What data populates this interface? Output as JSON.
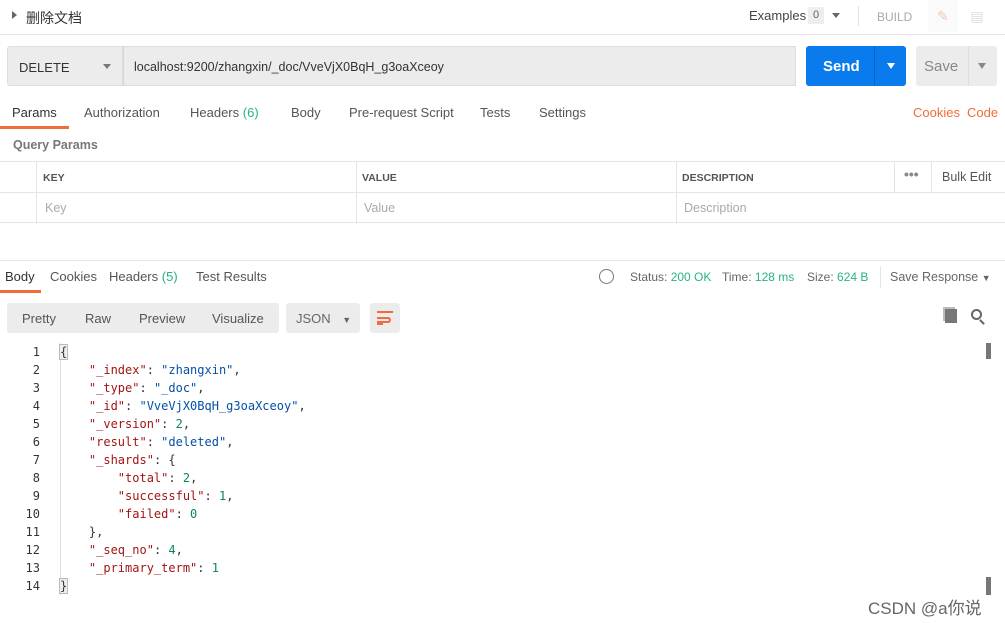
{
  "header": {
    "title": "删除文档",
    "examples_label": "Examples",
    "examples_count": "0",
    "build_label": "BUILD",
    "edit_icon": "pencil-icon",
    "comment_icon": "comment-icon"
  },
  "request": {
    "method": "DELETE",
    "url": "localhost:9200/zhangxin/_doc/VveVjX0BqH_g3oaXceoy",
    "send_label": "Send",
    "save_label": "Save"
  },
  "request_tabs": [
    {
      "label": "Params"
    },
    {
      "label": "Authorization"
    },
    {
      "label": "Headers",
      "count": "(6)"
    },
    {
      "label": "Body"
    },
    {
      "label": "Pre-request Script"
    },
    {
      "label": "Tests"
    },
    {
      "label": "Settings"
    }
  ],
  "links": {
    "cookies": "Cookies",
    "code": "Code"
  },
  "query_params": {
    "title": "Query Params",
    "columns": [
      "KEY",
      "VALUE",
      "DESCRIPTION"
    ],
    "bulk_edit": "Bulk Edit",
    "placeholders": {
      "key": "Key",
      "value": "Value",
      "description": "Description"
    }
  },
  "response_tabs": [
    {
      "label": "Body"
    },
    {
      "label": "Cookies"
    },
    {
      "label": "Headers",
      "count": "(5)"
    },
    {
      "label": "Test Results"
    }
  ],
  "status": {
    "status_label": "Status:",
    "status_value": "200 OK",
    "time_label": "Time:",
    "time_value": "128 ms",
    "size_label": "Size:",
    "size_value": "624 B",
    "save_response": "Save Response"
  },
  "view_modes": [
    "Pretty",
    "Raw",
    "Preview",
    "Visualize"
  ],
  "format": "JSON",
  "colors": {
    "accent": "#f26b3a",
    "send": "#097bed",
    "success": "#26b47f",
    "json_key": "#a31515",
    "json_string": "#0451a5",
    "json_number": "#098658"
  },
  "code_lines": [
    [
      [
        "p",
        "{"
      ]
    ],
    [
      [
        "p",
        "    "
      ],
      [
        "k",
        "\"_index\""
      ],
      [
        "p",
        ": "
      ],
      [
        "s",
        "\"zhangxin\""
      ],
      [
        "p",
        ","
      ]
    ],
    [
      [
        "p",
        "    "
      ],
      [
        "k",
        "\"_type\""
      ],
      [
        "p",
        ": "
      ],
      [
        "s",
        "\"_doc\""
      ],
      [
        "p",
        ","
      ]
    ],
    [
      [
        "p",
        "    "
      ],
      [
        "k",
        "\"_id\""
      ],
      [
        "p",
        ": "
      ],
      [
        "s",
        "\"VveVjX0BqH_g3oaXceoy\""
      ],
      [
        "p",
        ","
      ]
    ],
    [
      [
        "p",
        "    "
      ],
      [
        "k",
        "\"_version\""
      ],
      [
        "p",
        ": "
      ],
      [
        "n",
        "2"
      ],
      [
        "p",
        ","
      ]
    ],
    [
      [
        "p",
        "    "
      ],
      [
        "k",
        "\"result\""
      ],
      [
        "p",
        ": "
      ],
      [
        "s",
        "\"deleted\""
      ],
      [
        "p",
        ","
      ]
    ],
    [
      [
        "p",
        "    "
      ],
      [
        "k",
        "\"_shards\""
      ],
      [
        "p",
        ": {"
      ]
    ],
    [
      [
        "p",
        "        "
      ],
      [
        "k",
        "\"total\""
      ],
      [
        "p",
        ": "
      ],
      [
        "n",
        "2"
      ],
      [
        "p",
        ","
      ]
    ],
    [
      [
        "p",
        "        "
      ],
      [
        "k",
        "\"successful\""
      ],
      [
        "p",
        ": "
      ],
      [
        "n",
        "1"
      ],
      [
        "p",
        ","
      ]
    ],
    [
      [
        "p",
        "        "
      ],
      [
        "k",
        "\"failed\""
      ],
      [
        "p",
        ": "
      ],
      [
        "n",
        "0"
      ]
    ],
    [
      [
        "p",
        "    },"
      ]
    ],
    [
      [
        "p",
        "    "
      ],
      [
        "k",
        "\"_seq_no\""
      ],
      [
        "p",
        ": "
      ],
      [
        "n",
        "4"
      ],
      [
        "p",
        ","
      ]
    ],
    [
      [
        "p",
        "    "
      ],
      [
        "k",
        "\"_primary_term\""
      ],
      [
        "p",
        ": "
      ],
      [
        "n",
        "1"
      ]
    ],
    [
      [
        "p",
        "}"
      ]
    ]
  ],
  "watermark": "CSDN @a你说"
}
